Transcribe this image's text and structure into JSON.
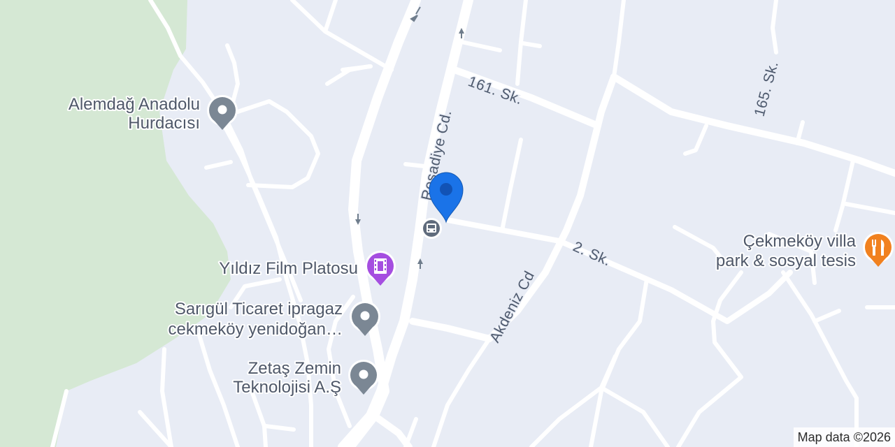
{
  "map": {
    "colors": {
      "land": "#e8ecf5",
      "park": "#d5e8d4",
      "road": "#ffffff",
      "location_pin": "#1a73e8",
      "poi_generic": "#7b8794",
      "poi_film": "#a54ee0",
      "poi_food": "#f1811f",
      "label_text": "#4f5869"
    },
    "street_labels": [
      {
        "id": "161-sk",
        "text": "161. Sk."
      },
      {
        "id": "165-sk",
        "text": "165. Sk."
      },
      {
        "id": "resadiye-cd",
        "text": "Reşadiye Cd."
      },
      {
        "id": "akdeniz-cd",
        "text": "Akdeniz Cd"
      },
      {
        "id": "2-sk",
        "text": "2. Sk."
      }
    ],
    "pois": [
      {
        "id": "alemdag",
        "lines": [
          "Alemdağ Anadolu",
          "Hurdacısı"
        ],
        "icon": "generic-place-icon"
      },
      {
        "id": "yildiz",
        "lines": [
          "Yıldız Film Platosu"
        ],
        "icon": "film-icon"
      },
      {
        "id": "sarigul",
        "lines": [
          "Sarıgül Ticaret ipragaz",
          "cekmeköy yenidoğan…"
        ],
        "icon": "generic-place-icon"
      },
      {
        "id": "zetas",
        "lines": [
          "Zetaş Zemin",
          "Teknolojisi A.Ş"
        ],
        "icon": "generic-place-icon"
      },
      {
        "id": "cekmekoy",
        "lines": [
          "Çekmeköy villa",
          "park & sosyal tesis"
        ],
        "icon": "restaurant-icon"
      }
    ],
    "bus_stop": {
      "icon": "bus-stop-icon"
    },
    "location_pin": {
      "icon": "location-pin-icon"
    },
    "attribution": "Map data ©2026"
  }
}
